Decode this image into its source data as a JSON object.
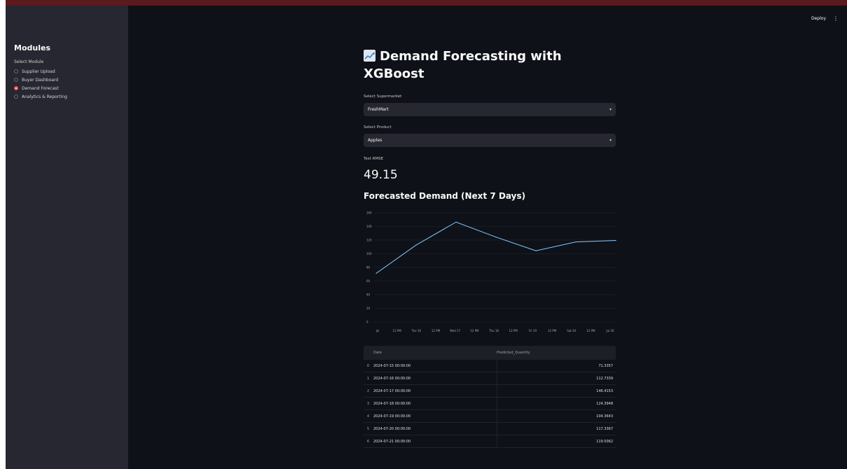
{
  "topbar": {
    "deploy_label": "Deploy",
    "menu_icon": "vertical-ellipsis-icon"
  },
  "sidebar": {
    "title": "Modules",
    "radio_label": "Select Module",
    "options": [
      {
        "label": "Supplier Upload",
        "selected": false
      },
      {
        "label": "Buyer Dashboard",
        "selected": false
      },
      {
        "label": "Demand Forecast",
        "selected": true
      },
      {
        "label": "Analytics & Reporting",
        "selected": false
      }
    ]
  },
  "main": {
    "title_icon": "chart-increasing-icon",
    "title_line1": "Demand Forecasting with",
    "title_line2": "XGBoost",
    "supermarket": {
      "label": "Select Supermarket",
      "value": "FreshMart"
    },
    "product": {
      "label": "Select Product",
      "value": "Apples"
    },
    "metric": {
      "label": "Test RMSE",
      "value": "49.15"
    },
    "chart_heading": "Forecasted Demand (Next 7 Days)"
  },
  "chart_data": {
    "type": "line",
    "y_ticks": [
      "0",
      "20",
      "40",
      "60",
      "80",
      "100",
      "120",
      "140",
      "160"
    ],
    "ylim": [
      0,
      160
    ],
    "x_ticks": [
      "Jul",
      "12 PM",
      "Tue 16",
      "12 PM",
      "Wed 17",
      "12 PM",
      "Thu 18",
      "12 PM",
      "Fri 19",
      "12 PM",
      "Sat 20",
      "12 PM",
      "Jul 20"
    ],
    "x": [
      "2024-07-15",
      "2024-07-16",
      "2024-07-17",
      "2024-07-18",
      "2024-07-19",
      "2024-07-20",
      "2024-07-21"
    ],
    "values": [
      71.3357,
      112.7339,
      146.4153,
      124.3948,
      104.3643,
      117.3367,
      119.5062
    ],
    "line_color": "#83c9ff",
    "grid": true
  },
  "table": {
    "columns": [
      "Date",
      "Predicted_Quantity"
    ],
    "rows": [
      {
        "index": "0",
        "date": "2024-07-15 00:00:00",
        "value": "71.3357"
      },
      {
        "index": "1",
        "date": "2024-07-16 00:00:00",
        "value": "112.7339"
      },
      {
        "index": "2",
        "date": "2024-07-17 00:00:00",
        "value": "146.4153"
      },
      {
        "index": "3",
        "date": "2024-07-18 00:00:00",
        "value": "124.3948"
      },
      {
        "index": "4",
        "date": "2024-07-19 00:00:00",
        "value": "104.3643"
      },
      {
        "index": "5",
        "date": "2024-07-20 00:00:00",
        "value": "117.3367"
      },
      {
        "index": "6",
        "date": "2024-07-21 00:00:00",
        "value": "119.5062"
      }
    ]
  },
  "colors": {
    "background": "#0e1117",
    "sidebar": "#262730",
    "accent": "#ff4b4b",
    "line": "#83c9ff"
  }
}
